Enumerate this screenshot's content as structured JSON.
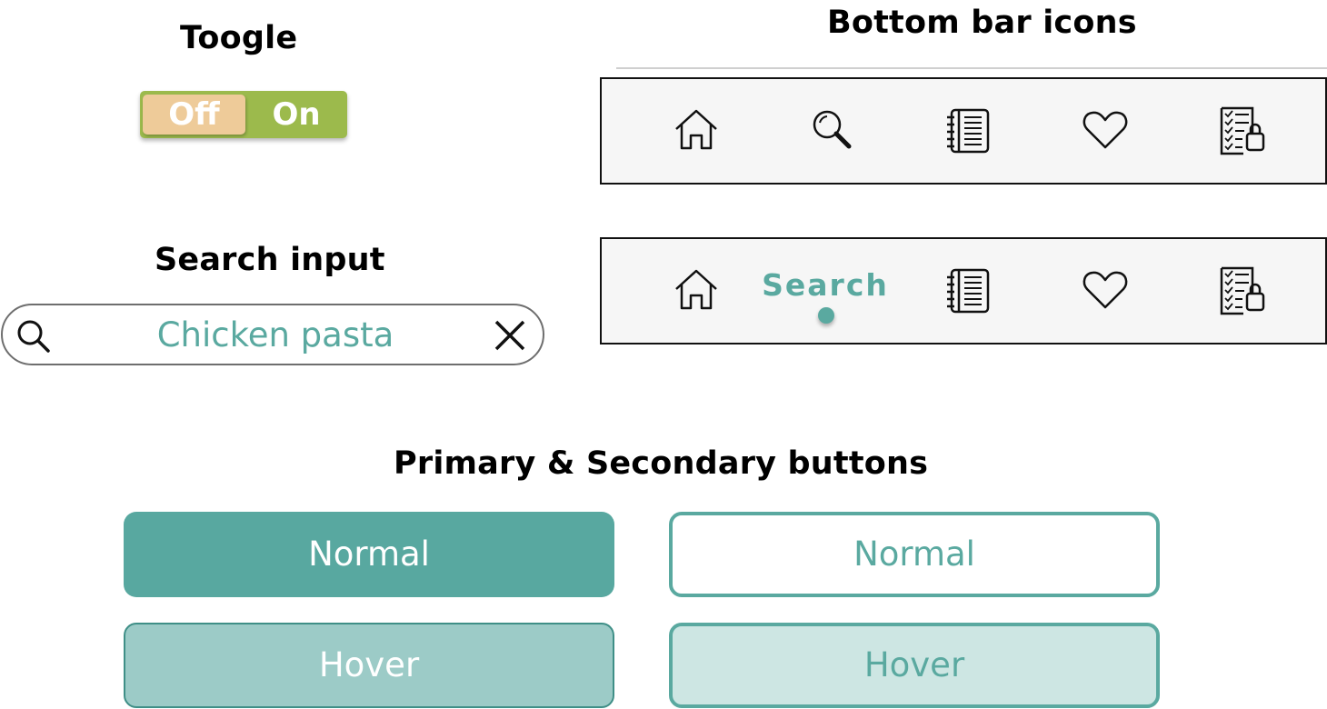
{
  "toggle": {
    "title": "Toogle",
    "off_label": "Off",
    "on_label": "On"
  },
  "search": {
    "title": "Search input",
    "value": "Chicken pasta"
  },
  "bottom_bar": {
    "title": "Bottom bar icons",
    "active_label": "Search"
  },
  "buttons": {
    "title": "Primary & Secondary buttons",
    "primary_normal": "Normal",
    "primary_hover": "Hover",
    "secondary_normal": "Normal",
    "secondary_hover": "Hover"
  },
  "icons": [
    "home-icon",
    "search-icon",
    "notebook-icon",
    "heart-icon",
    "shopping-list-icon",
    "close-icon"
  ],
  "colors": {
    "accent": "#5aa9a0",
    "toggle_on": "#9cba4c",
    "toggle_off": "#eecb99",
    "primary_hover": "#9ccbc7",
    "secondary_hover": "#cde6e3"
  }
}
